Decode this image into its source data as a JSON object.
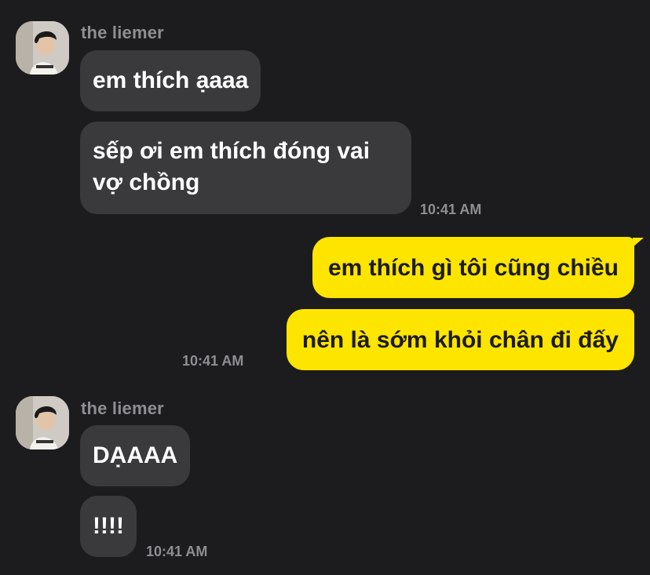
{
  "conversation": {
    "group1": {
      "sender_name": "the liemer",
      "messages": [
        "em thích ạaaa",
        "sếp ơi em thích đóng vai vợ chồng"
      ],
      "time": "10:41 AM"
    },
    "group2": {
      "messages": [
        "em thích gì tôi cũng chiều",
        "nên là sớm khỏi chân đi đấy"
      ],
      "time": "10:41 AM"
    },
    "group3": {
      "sender_name": "the liemer",
      "messages": [
        "DẠAAA",
        "!!!!"
      ],
      "time": "10:41 AM"
    }
  },
  "colors": {
    "background": "#1c1c1e",
    "incoming_bubble": "#3a3a3c",
    "outgoing_bubble": "#fee500",
    "timestamp": "#8e8e93"
  },
  "icons": {
    "avatar": "profile-photo-avatar"
  }
}
